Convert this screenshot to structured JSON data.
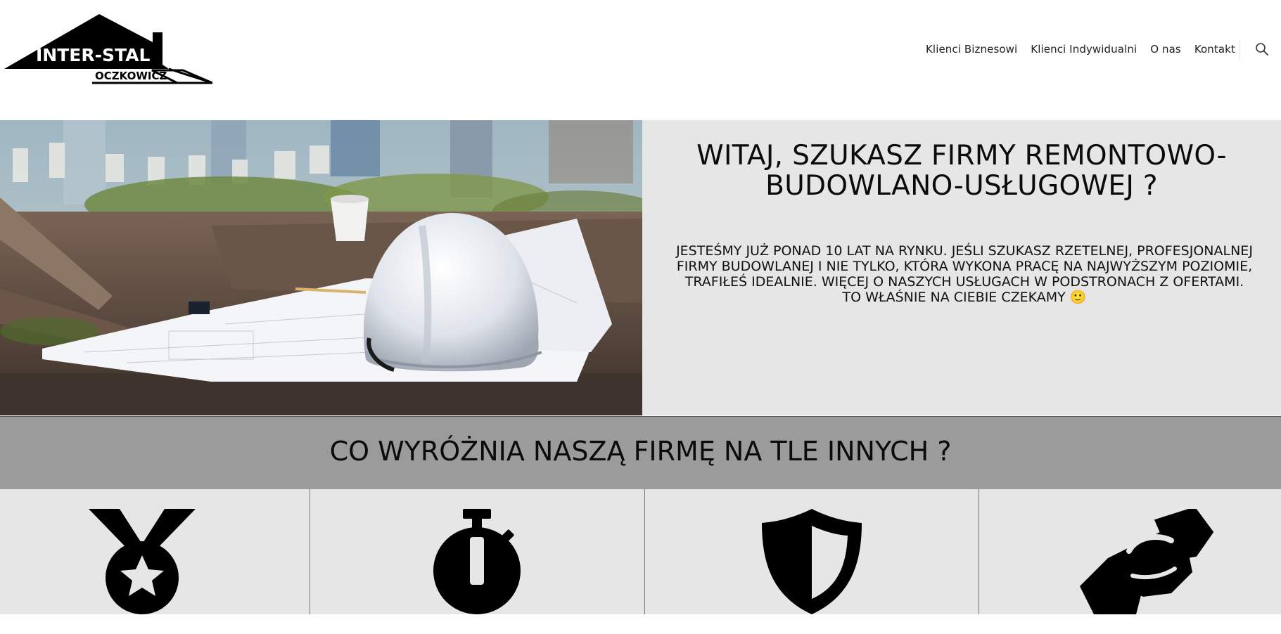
{
  "site": {
    "logo_line1": "INTER-STAL",
    "logo_line2": "OCZKOWICZ"
  },
  "nav": {
    "items": [
      {
        "label": "Klienci Biznesowi"
      },
      {
        "label": "Klienci Indywidualni"
      },
      {
        "label": "O nas"
      },
      {
        "label": "Kontakt"
      }
    ],
    "search_icon": "search-icon"
  },
  "hero": {
    "title": "WITAJ, SZUKASZ FIRMY REMONTOWO-BUDOWLANO-USŁUGOWEJ ?",
    "text": "JESTEŚMY JUŻ PONAD 10 LAT NA RYNKU. JEŚLI SZUKASZ RZETELNEJ, PROFESJONALNEJ FIRMY BUDOWLANEJ I NIE TYLKO, KTÓRA WYKONA PRACĘ NA NAJWYŻSZYM POZIOMIE, TRAFIŁEŚ IDEALNIE. WIĘCEJ O NASZYCH USŁUGACH W PODSTRONACH Z OFERTAMI. TO WŁAŚNIE NA CIEBIE CZEKAMY 🙂",
    "image": "hard-hat-on-blueprints"
  },
  "features": {
    "title": "CO WYRÓŻNIA NASZĄ FIRMĘ NA TLE INNYCH ?",
    "icons": [
      "medal-icon",
      "stopwatch-icon",
      "shield-icon",
      "handshake-icon"
    ]
  },
  "colors": {
    "panel_bg": "#e6e6e7",
    "band_bg": "#9b9b9b",
    "text": "#0b0b0b"
  }
}
